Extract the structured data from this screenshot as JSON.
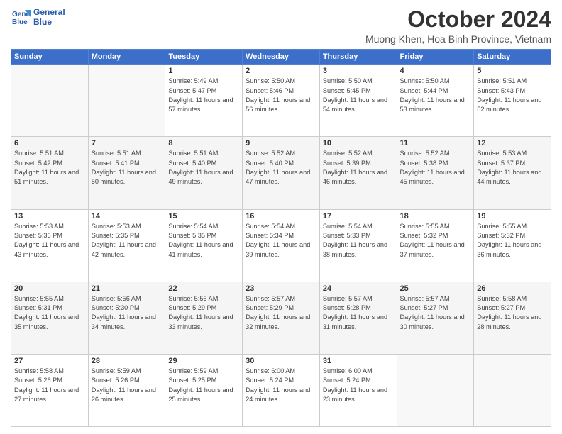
{
  "header": {
    "logo_line1": "General",
    "logo_line2": "Blue",
    "month": "October 2024",
    "location": "Muong Khen, Hoa Binh Province, Vietnam"
  },
  "weekdays": [
    "Sunday",
    "Monday",
    "Tuesday",
    "Wednesday",
    "Thursday",
    "Friday",
    "Saturday"
  ],
  "weeks": [
    [
      {
        "day": "",
        "info": ""
      },
      {
        "day": "",
        "info": ""
      },
      {
        "day": "1",
        "info": "Sunrise: 5:49 AM\nSunset: 5:47 PM\nDaylight: 11 hours and 57 minutes."
      },
      {
        "day": "2",
        "info": "Sunrise: 5:50 AM\nSunset: 5:46 PM\nDaylight: 11 hours and 56 minutes."
      },
      {
        "day": "3",
        "info": "Sunrise: 5:50 AM\nSunset: 5:45 PM\nDaylight: 11 hours and 54 minutes."
      },
      {
        "day": "4",
        "info": "Sunrise: 5:50 AM\nSunset: 5:44 PM\nDaylight: 11 hours and 53 minutes."
      },
      {
        "day": "5",
        "info": "Sunrise: 5:51 AM\nSunset: 5:43 PM\nDaylight: 11 hours and 52 minutes."
      }
    ],
    [
      {
        "day": "6",
        "info": "Sunrise: 5:51 AM\nSunset: 5:42 PM\nDaylight: 11 hours and 51 minutes."
      },
      {
        "day": "7",
        "info": "Sunrise: 5:51 AM\nSunset: 5:41 PM\nDaylight: 11 hours and 50 minutes."
      },
      {
        "day": "8",
        "info": "Sunrise: 5:51 AM\nSunset: 5:40 PM\nDaylight: 11 hours and 49 minutes."
      },
      {
        "day": "9",
        "info": "Sunrise: 5:52 AM\nSunset: 5:40 PM\nDaylight: 11 hours and 47 minutes."
      },
      {
        "day": "10",
        "info": "Sunrise: 5:52 AM\nSunset: 5:39 PM\nDaylight: 11 hours and 46 minutes."
      },
      {
        "day": "11",
        "info": "Sunrise: 5:52 AM\nSunset: 5:38 PM\nDaylight: 11 hours and 45 minutes."
      },
      {
        "day": "12",
        "info": "Sunrise: 5:53 AM\nSunset: 5:37 PM\nDaylight: 11 hours and 44 minutes."
      }
    ],
    [
      {
        "day": "13",
        "info": "Sunrise: 5:53 AM\nSunset: 5:36 PM\nDaylight: 11 hours and 43 minutes."
      },
      {
        "day": "14",
        "info": "Sunrise: 5:53 AM\nSunset: 5:35 PM\nDaylight: 11 hours and 42 minutes."
      },
      {
        "day": "15",
        "info": "Sunrise: 5:54 AM\nSunset: 5:35 PM\nDaylight: 11 hours and 41 minutes."
      },
      {
        "day": "16",
        "info": "Sunrise: 5:54 AM\nSunset: 5:34 PM\nDaylight: 11 hours and 39 minutes."
      },
      {
        "day": "17",
        "info": "Sunrise: 5:54 AM\nSunset: 5:33 PM\nDaylight: 11 hours and 38 minutes."
      },
      {
        "day": "18",
        "info": "Sunrise: 5:55 AM\nSunset: 5:32 PM\nDaylight: 11 hours and 37 minutes."
      },
      {
        "day": "19",
        "info": "Sunrise: 5:55 AM\nSunset: 5:32 PM\nDaylight: 11 hours and 36 minutes."
      }
    ],
    [
      {
        "day": "20",
        "info": "Sunrise: 5:55 AM\nSunset: 5:31 PM\nDaylight: 11 hours and 35 minutes."
      },
      {
        "day": "21",
        "info": "Sunrise: 5:56 AM\nSunset: 5:30 PM\nDaylight: 11 hours and 34 minutes."
      },
      {
        "day": "22",
        "info": "Sunrise: 5:56 AM\nSunset: 5:29 PM\nDaylight: 11 hours and 33 minutes."
      },
      {
        "day": "23",
        "info": "Sunrise: 5:57 AM\nSunset: 5:29 PM\nDaylight: 11 hours and 32 minutes."
      },
      {
        "day": "24",
        "info": "Sunrise: 5:57 AM\nSunset: 5:28 PM\nDaylight: 11 hours and 31 minutes."
      },
      {
        "day": "25",
        "info": "Sunrise: 5:57 AM\nSunset: 5:27 PM\nDaylight: 11 hours and 30 minutes."
      },
      {
        "day": "26",
        "info": "Sunrise: 5:58 AM\nSunset: 5:27 PM\nDaylight: 11 hours and 28 minutes."
      }
    ],
    [
      {
        "day": "27",
        "info": "Sunrise: 5:58 AM\nSunset: 5:26 PM\nDaylight: 11 hours and 27 minutes."
      },
      {
        "day": "28",
        "info": "Sunrise: 5:59 AM\nSunset: 5:26 PM\nDaylight: 11 hours and 26 minutes."
      },
      {
        "day": "29",
        "info": "Sunrise: 5:59 AM\nSunset: 5:25 PM\nDaylight: 11 hours and 25 minutes."
      },
      {
        "day": "30",
        "info": "Sunrise: 6:00 AM\nSunset: 5:24 PM\nDaylight: 11 hours and 24 minutes."
      },
      {
        "day": "31",
        "info": "Sunrise: 6:00 AM\nSunset: 5:24 PM\nDaylight: 11 hours and 23 minutes."
      },
      {
        "day": "",
        "info": ""
      },
      {
        "day": "",
        "info": ""
      }
    ]
  ]
}
